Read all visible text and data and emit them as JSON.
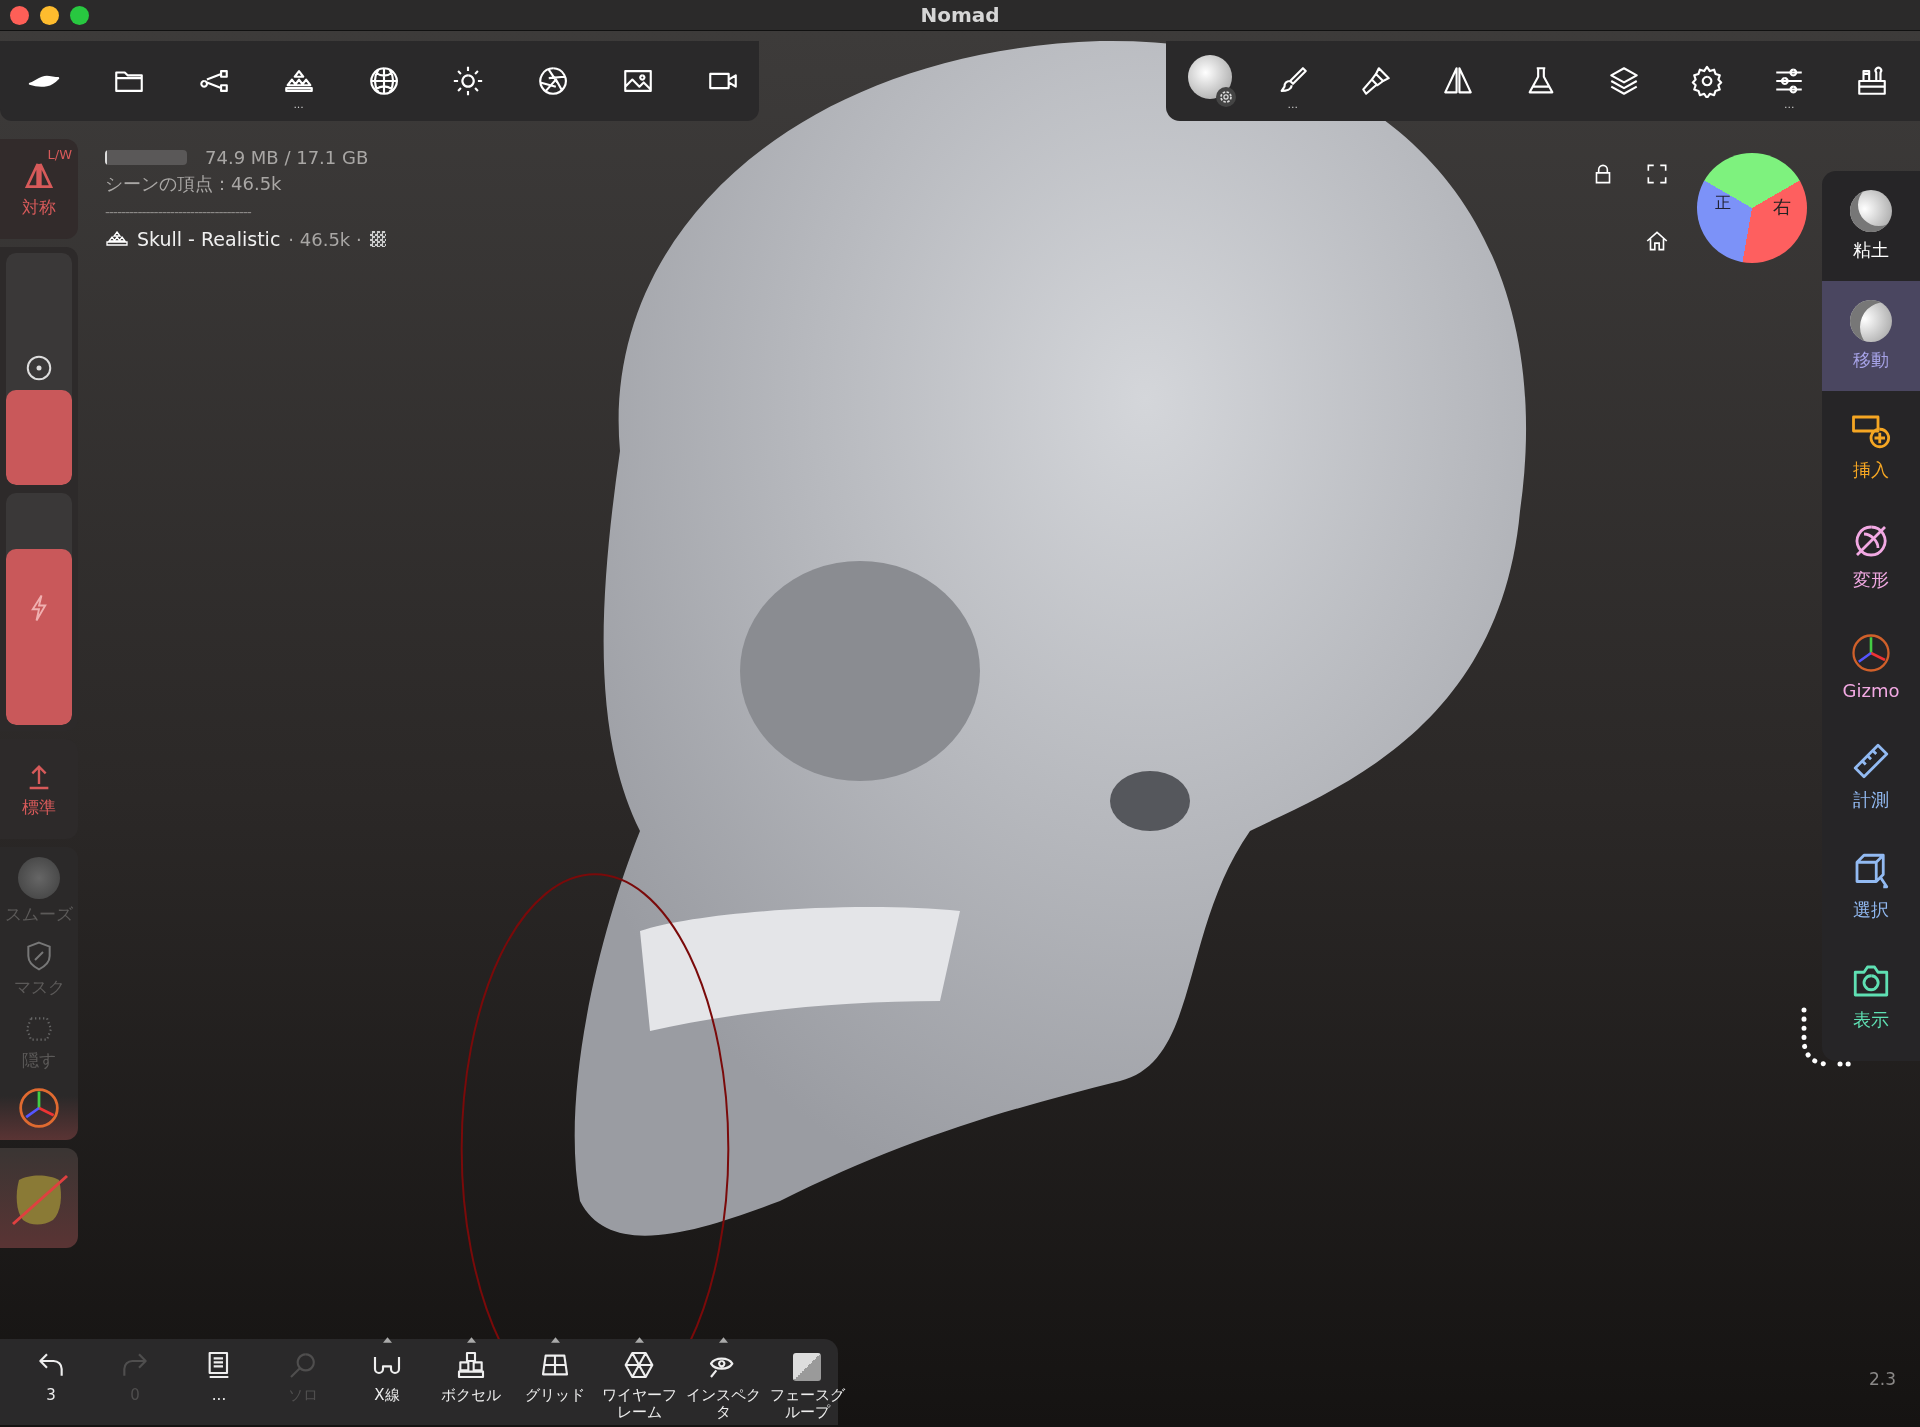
{
  "window": {
    "title": "Nomad"
  },
  "top_left_toolbar": [
    {
      "menu": false
    },
    {
      "menu": false
    },
    {
      "menu": false
    },
    {
      "menu": true,
      "hint": "..."
    },
    {
      "menu": false
    },
    {
      "menu": false
    },
    {
      "menu": false
    },
    {
      "menu": false
    },
    {
      "menu": false
    }
  ],
  "top_right_toolbar": [
    {
      "menu": false
    },
    {
      "menu": true,
      "hint": "..."
    },
    {
      "menu": false
    },
    {
      "menu": false
    },
    {
      "menu": false
    },
    {
      "menu": false
    },
    {
      "menu": false
    },
    {
      "menu": true,
      "hint": "..."
    },
    {
      "menu": false
    }
  ],
  "info": {
    "memory": {
      "level": 0.03,
      "reading": "74.9 MB / 17.1 GB"
    },
    "vertices": "シーンの頂点：46.5k",
    "divider": "------------------------------------",
    "object": {
      "name": "Skull - Realistic",
      "count": "· 46.5k ·"
    }
  },
  "view_cube": {
    "front": "正",
    "right": "右"
  },
  "left_toolbar": {
    "symmetry": {
      "label": "対称",
      "badge": "L/W"
    },
    "sliders": [
      {
        "kind": "radius",
        "level": 0.41
      },
      {
        "kind": "intensity",
        "level": 0.76
      }
    ],
    "mode": {
      "label": "標準"
    },
    "tools": [
      {
        "label": "スムーズ",
        "disabled": true
      },
      {
        "label": "マスク",
        "disabled": true
      },
      {
        "label": "隠す",
        "disabled": true
      }
    ]
  },
  "right_toolbar": [
    {
      "label": "粘土",
      "color": "#ffffff",
      "selected": false
    },
    {
      "label": "移動",
      "color": "#a6a2e6",
      "selected": true
    },
    {
      "label": "挿入",
      "color": "#f5a623",
      "selected": false
    },
    {
      "label": "変形",
      "color": "#f2a9e3",
      "selected": false
    },
    {
      "label": "Gizmo",
      "color": "#f2a9e3",
      "selected": false
    },
    {
      "label": "計測",
      "color": "#92baf2",
      "selected": false
    },
    {
      "label": "選択",
      "color": "#92baf2",
      "selected": false
    },
    {
      "label": "表示",
      "color": "#5fe0b3",
      "selected": false
    }
  ],
  "bottom_toolbar": [
    {
      "label": "3",
      "disabled": false,
      "has_menu": false
    },
    {
      "label": "0",
      "disabled": true,
      "has_menu": false
    },
    {
      "label": "...",
      "disabled": false,
      "has_menu": false
    },
    {
      "label": "ソロ",
      "disabled": true,
      "has_menu": false
    },
    {
      "label": "X線",
      "disabled": false,
      "has_menu": true
    },
    {
      "label": "ボクセル",
      "disabled": false,
      "has_menu": true
    },
    {
      "label": "グリッド",
      "disabled": false,
      "has_menu": true
    },
    {
      "label": "ワイヤーフレーム",
      "disabled": false,
      "has_menu": true
    },
    {
      "label": "インスペクタ",
      "disabled": false,
      "has_menu": true
    },
    {
      "label": "フェースグループ",
      "disabled": false,
      "has_menu": false
    }
  ],
  "version": "2.3"
}
